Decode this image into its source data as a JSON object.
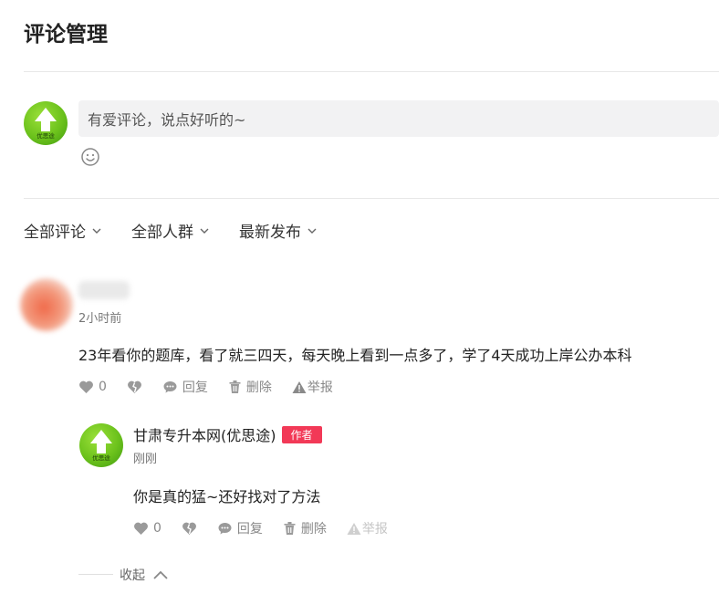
{
  "page": {
    "title": "评论管理"
  },
  "composer": {
    "placeholder": "有爱评论，说点好听的~",
    "avatar_text": "优思途"
  },
  "filters": [
    {
      "label": "全部评论"
    },
    {
      "label": "全部人群"
    },
    {
      "label": "最新发布"
    }
  ],
  "comment": {
    "time": "2小时前",
    "content": "23年看你的题库，看了就三四天，每天晚上看到一点多了，学了4天成功上岸公办本科",
    "likes": "0",
    "reply_label": "回复",
    "delete_label": "删除",
    "report_label": "举报"
  },
  "reply": {
    "author": "甘肃专升本网(优思途)",
    "badge": "作者",
    "time": "刚刚",
    "content": "你是真的猛~还好找对了方法",
    "likes": "0",
    "reply_label": "回复",
    "delete_label": "删除",
    "report_label": "举报",
    "avatar_text": "优思途"
  },
  "collapse_label": "收起",
  "colors": {
    "badge": "#f23957",
    "avatar_green": "#6cc21c",
    "input_bg": "#f2f2f3"
  }
}
